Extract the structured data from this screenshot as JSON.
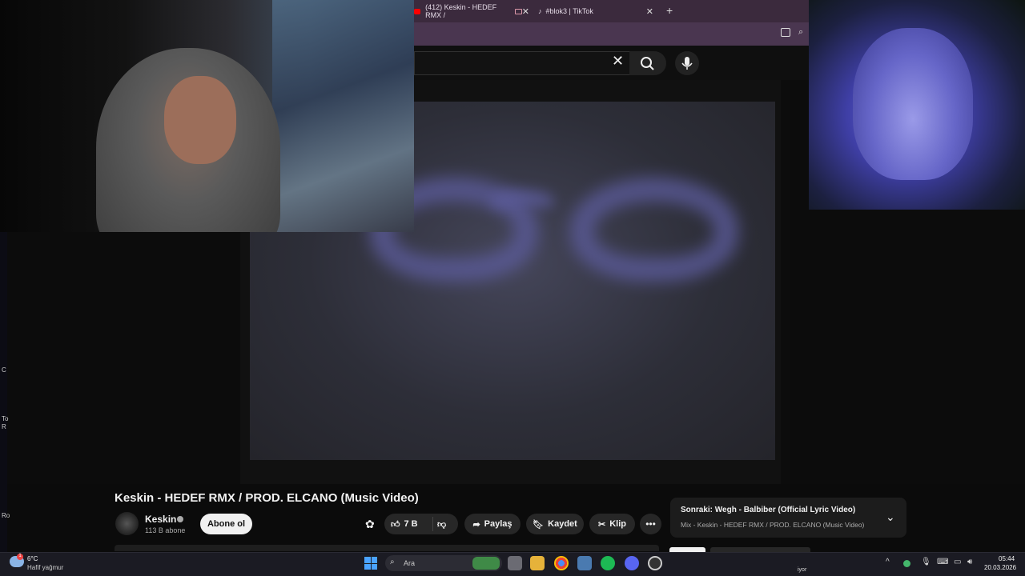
{
  "browser": {
    "tabs": [
      {
        "label": "(412) Keskin - HEDEF RMX /"
      },
      {
        "label": "#blok3 | TikTok"
      }
    ],
    "new_tab": "+"
  },
  "video": {
    "title": "Keskin - HEDEF RMX / PROD. ELCANO (Music Video)",
    "channel": "Keskin",
    "subscribers": "113 B abone",
    "subscribe_label": "Abone ol",
    "likes": "7 B",
    "share_label": "Paylaş",
    "save_label": "Kaydet",
    "clip_label": "Klip"
  },
  "up_next": {
    "title": "Sonraki: Wegh - Balbiber (Official Lyric Video)",
    "subtitle": "Mix - Keskin - HEDEF RMX / PROD. ELCANO (Music Video)"
  },
  "left_edge": [
    "C",
    "To",
    "R",
    "Ro"
  ],
  "taskbar": {
    "weather_temp": "6°C",
    "weather_desc": "Hafif yağmur",
    "weather_badge": "1",
    "search_label": "Ara",
    "tray_text": "iyor",
    "time": "05:44",
    "date": "20.03.2026"
  },
  "icons": [
    "search-icon",
    "microphone-icon",
    "close-icon",
    "like-icon",
    "dislike-icon",
    "share-icon",
    "save-icon",
    "clip-icon",
    "more-icon",
    "chevron-down-icon",
    "windows-start-icon"
  ],
  "colors": {
    "accent_tab": "#3b2a3d",
    "subscribe_bg": "#f1f1f1",
    "taskbar": "#1b1b23"
  }
}
